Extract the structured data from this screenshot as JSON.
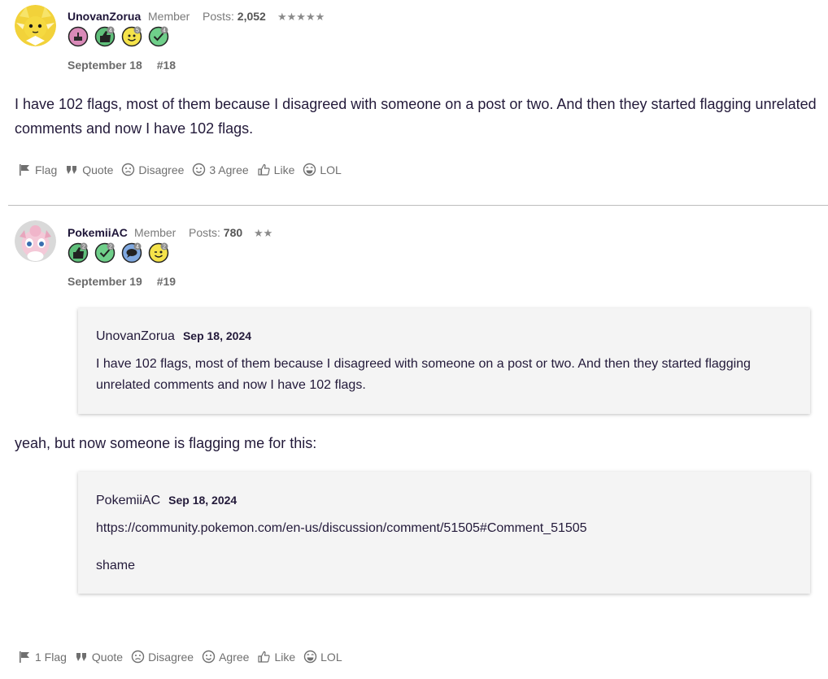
{
  "post1": {
    "username": "UnovanZorua",
    "role": "Member",
    "posts_label": "Posts:",
    "posts_count": "2,052",
    "stars": "★★★★★",
    "badges": [
      {
        "icon": "cake-icon",
        "color": "#d98ab8",
        "count": ""
      },
      {
        "icon": "thumbs-up-icon",
        "color": "#5fbf7a",
        "count": "4"
      },
      {
        "icon": "smiley-face-icon",
        "color": "#f5e34a",
        "count": "5"
      },
      {
        "icon": "checkmark-icon",
        "color": "#6fcf8a",
        "count": "4"
      }
    ],
    "date": "September 18",
    "number": "#18",
    "text": "I have 102 flags, most of them because I disagreed with someone on a post or two. And then they started flagging unrelated comments and now I have 102 flags.",
    "actions": {
      "flag": "Flag",
      "quote": "Quote",
      "disagree": "Disagree",
      "agree": "3 Agree",
      "like": "Like",
      "lol": "LOL"
    }
  },
  "post2": {
    "username": "PokemiiAC",
    "role": "Member",
    "posts_label": "Posts:",
    "posts_count": "780",
    "stars": "★★",
    "badges": [
      {
        "icon": "thumbs-up-icon",
        "color": "#5fbf7a",
        "count": "2"
      },
      {
        "icon": "checkmark-icon",
        "color": "#6fcf8a",
        "count": "2"
      },
      {
        "icon": "comment-icon",
        "color": "#7fa8e0",
        "count": "4"
      },
      {
        "icon": "wink-face-icon",
        "color": "#f5e34a",
        "count": "2"
      }
    ],
    "date": "September 19",
    "number": "#19",
    "quote1": {
      "author": "UnovanZorua",
      "date": "Sep 18, 2024",
      "text": "I have 102 flags, most of them because I disagreed with someone on a post or two. And then they started flagging unrelated comments and now I have 102 flags."
    },
    "text": "yeah, but now someone is flagging me for this:",
    "quote2": {
      "author": "PokemiiAC",
      "date": "Sep 18, 2024",
      "link": "https://community.pokemon.com/en-us/discussion/comment/51505#Comment_51505",
      "text": "shame"
    },
    "actions": {
      "flag": "1 Flag",
      "quote": "Quote",
      "disagree": "Disagree",
      "agree": "Agree",
      "like": "Like",
      "lol": "LOL"
    }
  }
}
